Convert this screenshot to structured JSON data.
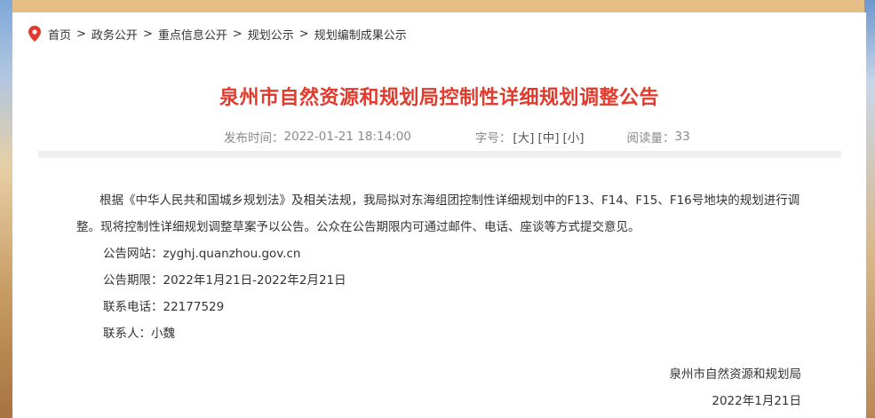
{
  "breadcrumb": {
    "items": [
      "首页",
      "政务公开",
      "重点信息公开",
      "规划公示",
      "规划编制成果公示"
    ],
    "separator": ">"
  },
  "article": {
    "title": "泉州市自然资源和规划局控制性详细规划调整公告",
    "publish_label": "发布时间：",
    "publish_time": "2022-01-21 18:14:00",
    "font_size_label": "字号：",
    "font_size_large": "[大]",
    "font_size_medium": "[中]",
    "font_size_small": "[小]",
    "read_label": "阅读量：",
    "read_count": "33",
    "paragraph1": "根据《中华人民共和国城乡规划法》及相关法规，我局拟对东海组团控制性详细规划中的F13、F14、F15、F16号地块的规划进行调整。现将控制性详细规划调整草案予以公告。公众在公告期限内可通过邮件、电话、座谈等方式提交意见。",
    "website_line": "公告网站：zyghj.quanzhou.gov.cn",
    "period_line": "公告期限：2022年1月21日-2022年2月21日",
    "phone_line": "联系电话：22177529",
    "contact_line": "联系人：小魏",
    "signature_org": "泉州市自然资源和规划局",
    "signature_date": "2022年1月21日"
  },
  "colors": {
    "title": "#e23a2c",
    "pin": "#e23a2c",
    "meta": "#8a8a8a"
  }
}
